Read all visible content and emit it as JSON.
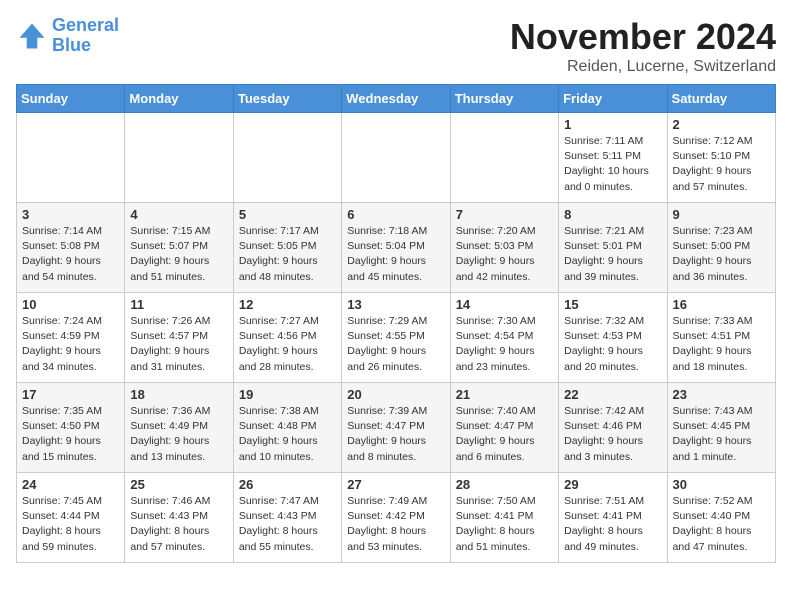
{
  "logo": {
    "line1": "General",
    "line2": "Blue"
  },
  "title": "November 2024",
  "subtitle": "Reiden, Lucerne, Switzerland",
  "days_of_week": [
    "Sunday",
    "Monday",
    "Tuesday",
    "Wednesday",
    "Thursday",
    "Friday",
    "Saturday"
  ],
  "weeks": [
    [
      {
        "day": "",
        "info": ""
      },
      {
        "day": "",
        "info": ""
      },
      {
        "day": "",
        "info": ""
      },
      {
        "day": "",
        "info": ""
      },
      {
        "day": "",
        "info": ""
      },
      {
        "day": "1",
        "info": "Sunrise: 7:11 AM\nSunset: 5:11 PM\nDaylight: 10 hours\nand 0 minutes."
      },
      {
        "day": "2",
        "info": "Sunrise: 7:12 AM\nSunset: 5:10 PM\nDaylight: 9 hours\nand 57 minutes."
      }
    ],
    [
      {
        "day": "3",
        "info": "Sunrise: 7:14 AM\nSunset: 5:08 PM\nDaylight: 9 hours\nand 54 minutes."
      },
      {
        "day": "4",
        "info": "Sunrise: 7:15 AM\nSunset: 5:07 PM\nDaylight: 9 hours\nand 51 minutes."
      },
      {
        "day": "5",
        "info": "Sunrise: 7:17 AM\nSunset: 5:05 PM\nDaylight: 9 hours\nand 48 minutes."
      },
      {
        "day": "6",
        "info": "Sunrise: 7:18 AM\nSunset: 5:04 PM\nDaylight: 9 hours\nand 45 minutes."
      },
      {
        "day": "7",
        "info": "Sunrise: 7:20 AM\nSunset: 5:03 PM\nDaylight: 9 hours\nand 42 minutes."
      },
      {
        "day": "8",
        "info": "Sunrise: 7:21 AM\nSunset: 5:01 PM\nDaylight: 9 hours\nand 39 minutes."
      },
      {
        "day": "9",
        "info": "Sunrise: 7:23 AM\nSunset: 5:00 PM\nDaylight: 9 hours\nand 36 minutes."
      }
    ],
    [
      {
        "day": "10",
        "info": "Sunrise: 7:24 AM\nSunset: 4:59 PM\nDaylight: 9 hours\nand 34 minutes."
      },
      {
        "day": "11",
        "info": "Sunrise: 7:26 AM\nSunset: 4:57 PM\nDaylight: 9 hours\nand 31 minutes."
      },
      {
        "day": "12",
        "info": "Sunrise: 7:27 AM\nSunset: 4:56 PM\nDaylight: 9 hours\nand 28 minutes."
      },
      {
        "day": "13",
        "info": "Sunrise: 7:29 AM\nSunset: 4:55 PM\nDaylight: 9 hours\nand 26 minutes."
      },
      {
        "day": "14",
        "info": "Sunrise: 7:30 AM\nSunset: 4:54 PM\nDaylight: 9 hours\nand 23 minutes."
      },
      {
        "day": "15",
        "info": "Sunrise: 7:32 AM\nSunset: 4:53 PM\nDaylight: 9 hours\nand 20 minutes."
      },
      {
        "day": "16",
        "info": "Sunrise: 7:33 AM\nSunset: 4:51 PM\nDaylight: 9 hours\nand 18 minutes."
      }
    ],
    [
      {
        "day": "17",
        "info": "Sunrise: 7:35 AM\nSunset: 4:50 PM\nDaylight: 9 hours\nand 15 minutes."
      },
      {
        "day": "18",
        "info": "Sunrise: 7:36 AM\nSunset: 4:49 PM\nDaylight: 9 hours\nand 13 minutes."
      },
      {
        "day": "19",
        "info": "Sunrise: 7:38 AM\nSunset: 4:48 PM\nDaylight: 9 hours\nand 10 minutes."
      },
      {
        "day": "20",
        "info": "Sunrise: 7:39 AM\nSunset: 4:47 PM\nDaylight: 9 hours\nand 8 minutes."
      },
      {
        "day": "21",
        "info": "Sunrise: 7:40 AM\nSunset: 4:47 PM\nDaylight: 9 hours\nand 6 minutes."
      },
      {
        "day": "22",
        "info": "Sunrise: 7:42 AM\nSunset: 4:46 PM\nDaylight: 9 hours\nand 3 minutes."
      },
      {
        "day": "23",
        "info": "Sunrise: 7:43 AM\nSunset: 4:45 PM\nDaylight: 9 hours\nand 1 minute."
      }
    ],
    [
      {
        "day": "24",
        "info": "Sunrise: 7:45 AM\nSunset: 4:44 PM\nDaylight: 8 hours\nand 59 minutes."
      },
      {
        "day": "25",
        "info": "Sunrise: 7:46 AM\nSunset: 4:43 PM\nDaylight: 8 hours\nand 57 minutes."
      },
      {
        "day": "26",
        "info": "Sunrise: 7:47 AM\nSunset: 4:43 PM\nDaylight: 8 hours\nand 55 minutes."
      },
      {
        "day": "27",
        "info": "Sunrise: 7:49 AM\nSunset: 4:42 PM\nDaylight: 8 hours\nand 53 minutes."
      },
      {
        "day": "28",
        "info": "Sunrise: 7:50 AM\nSunset: 4:41 PM\nDaylight: 8 hours\nand 51 minutes."
      },
      {
        "day": "29",
        "info": "Sunrise: 7:51 AM\nSunset: 4:41 PM\nDaylight: 8 hours\nand 49 minutes."
      },
      {
        "day": "30",
        "info": "Sunrise: 7:52 AM\nSunset: 4:40 PM\nDaylight: 8 hours\nand 47 minutes."
      }
    ]
  ]
}
